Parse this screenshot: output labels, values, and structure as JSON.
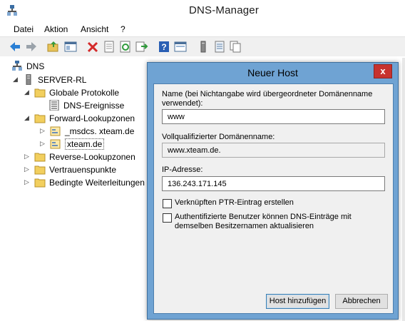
{
  "window": {
    "title": "DNS-Manager"
  },
  "menu": {
    "items": [
      "Datei",
      "Aktion",
      "Ansicht",
      "?"
    ]
  },
  "toolbar": {
    "buttons": [
      "back-arrow-icon",
      "forward-arrow-icon",
      "up-folder-icon",
      "show-hide-tree-icon",
      "delete-icon",
      "properties-icon",
      "refresh-icon",
      "export-icon",
      "help-icon",
      "console-icon",
      "server-icon",
      "list-icon",
      "copy-icon"
    ]
  },
  "tree": {
    "root": "DNS",
    "server": "SERVER-RL",
    "global_logs": "Globale Protokolle",
    "dns_events": "DNS-Ereignisse",
    "forward_zones": "Forward-Lookupzonen",
    "msdcs_zone": "_msdcs. xteam.de",
    "xteam_zone": "xteam.de",
    "reverse_zones": "Reverse-Lookupzonen",
    "trust_points": "Vertrauenspunkte",
    "conditional_forwarders": "Bedingte Weiterleitungen"
  },
  "dialog": {
    "title": "Neuer Host",
    "close": "x",
    "name_label": "Name (bei Nichtangabe wird übergeordneter Domänenname verwendet):",
    "name_value": "www",
    "fqdn_label": "Vollqualifizierter Domänenname:",
    "fqdn_value": "www.xteam.de.",
    "ip_label": "IP-Adresse:",
    "ip_value": "136.243.171.145",
    "ptr_checkbox_label": "Verknüpften PTR-Eintrag erstellen",
    "ptr_checked": false,
    "auth_checkbox_label": "Authentifizierte Benutzer können DNS-Einträge mit demselben Besitzernamen aktualisieren",
    "auth_checked": false,
    "add_host_button": "Host hinzufügen",
    "cancel_button": "Abbrechen"
  }
}
